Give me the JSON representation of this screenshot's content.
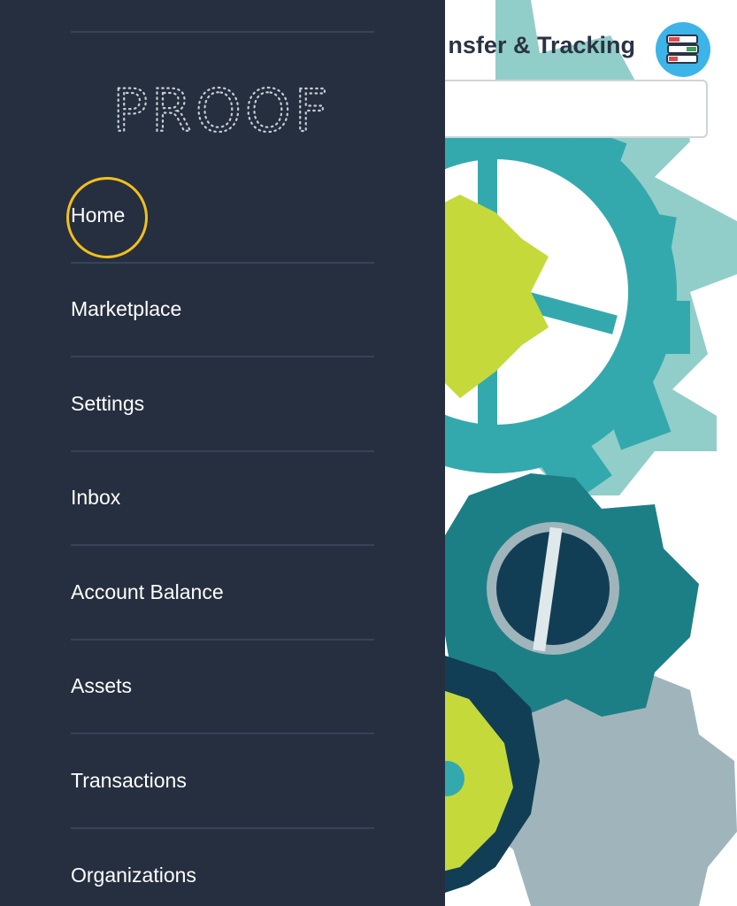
{
  "background": {
    "header_title": "nsfer & Tracking",
    "avatar_icon": "books-stack-icon",
    "colors": {
      "teal": "#34a9ad",
      "dark_teal": "#1d7f86",
      "lime": "#c5da3a",
      "pale_teal": "#7ec5bf",
      "navy": "#123e55",
      "grey_blue": "#9fb5bb",
      "avatar": "#3db4e8"
    }
  },
  "drawer": {
    "logo": "PROOF",
    "background_color": "#262f3f",
    "divider_color": "#38425a",
    "highlight_color": "#f2c01c",
    "items": [
      {
        "label": "Home"
      },
      {
        "label": "Marketplace"
      },
      {
        "label": "Settings"
      },
      {
        "label": "Inbox"
      },
      {
        "label": "Account Balance"
      },
      {
        "label": "Assets"
      },
      {
        "label": "Transactions"
      },
      {
        "label": "Organizations"
      }
    ]
  }
}
